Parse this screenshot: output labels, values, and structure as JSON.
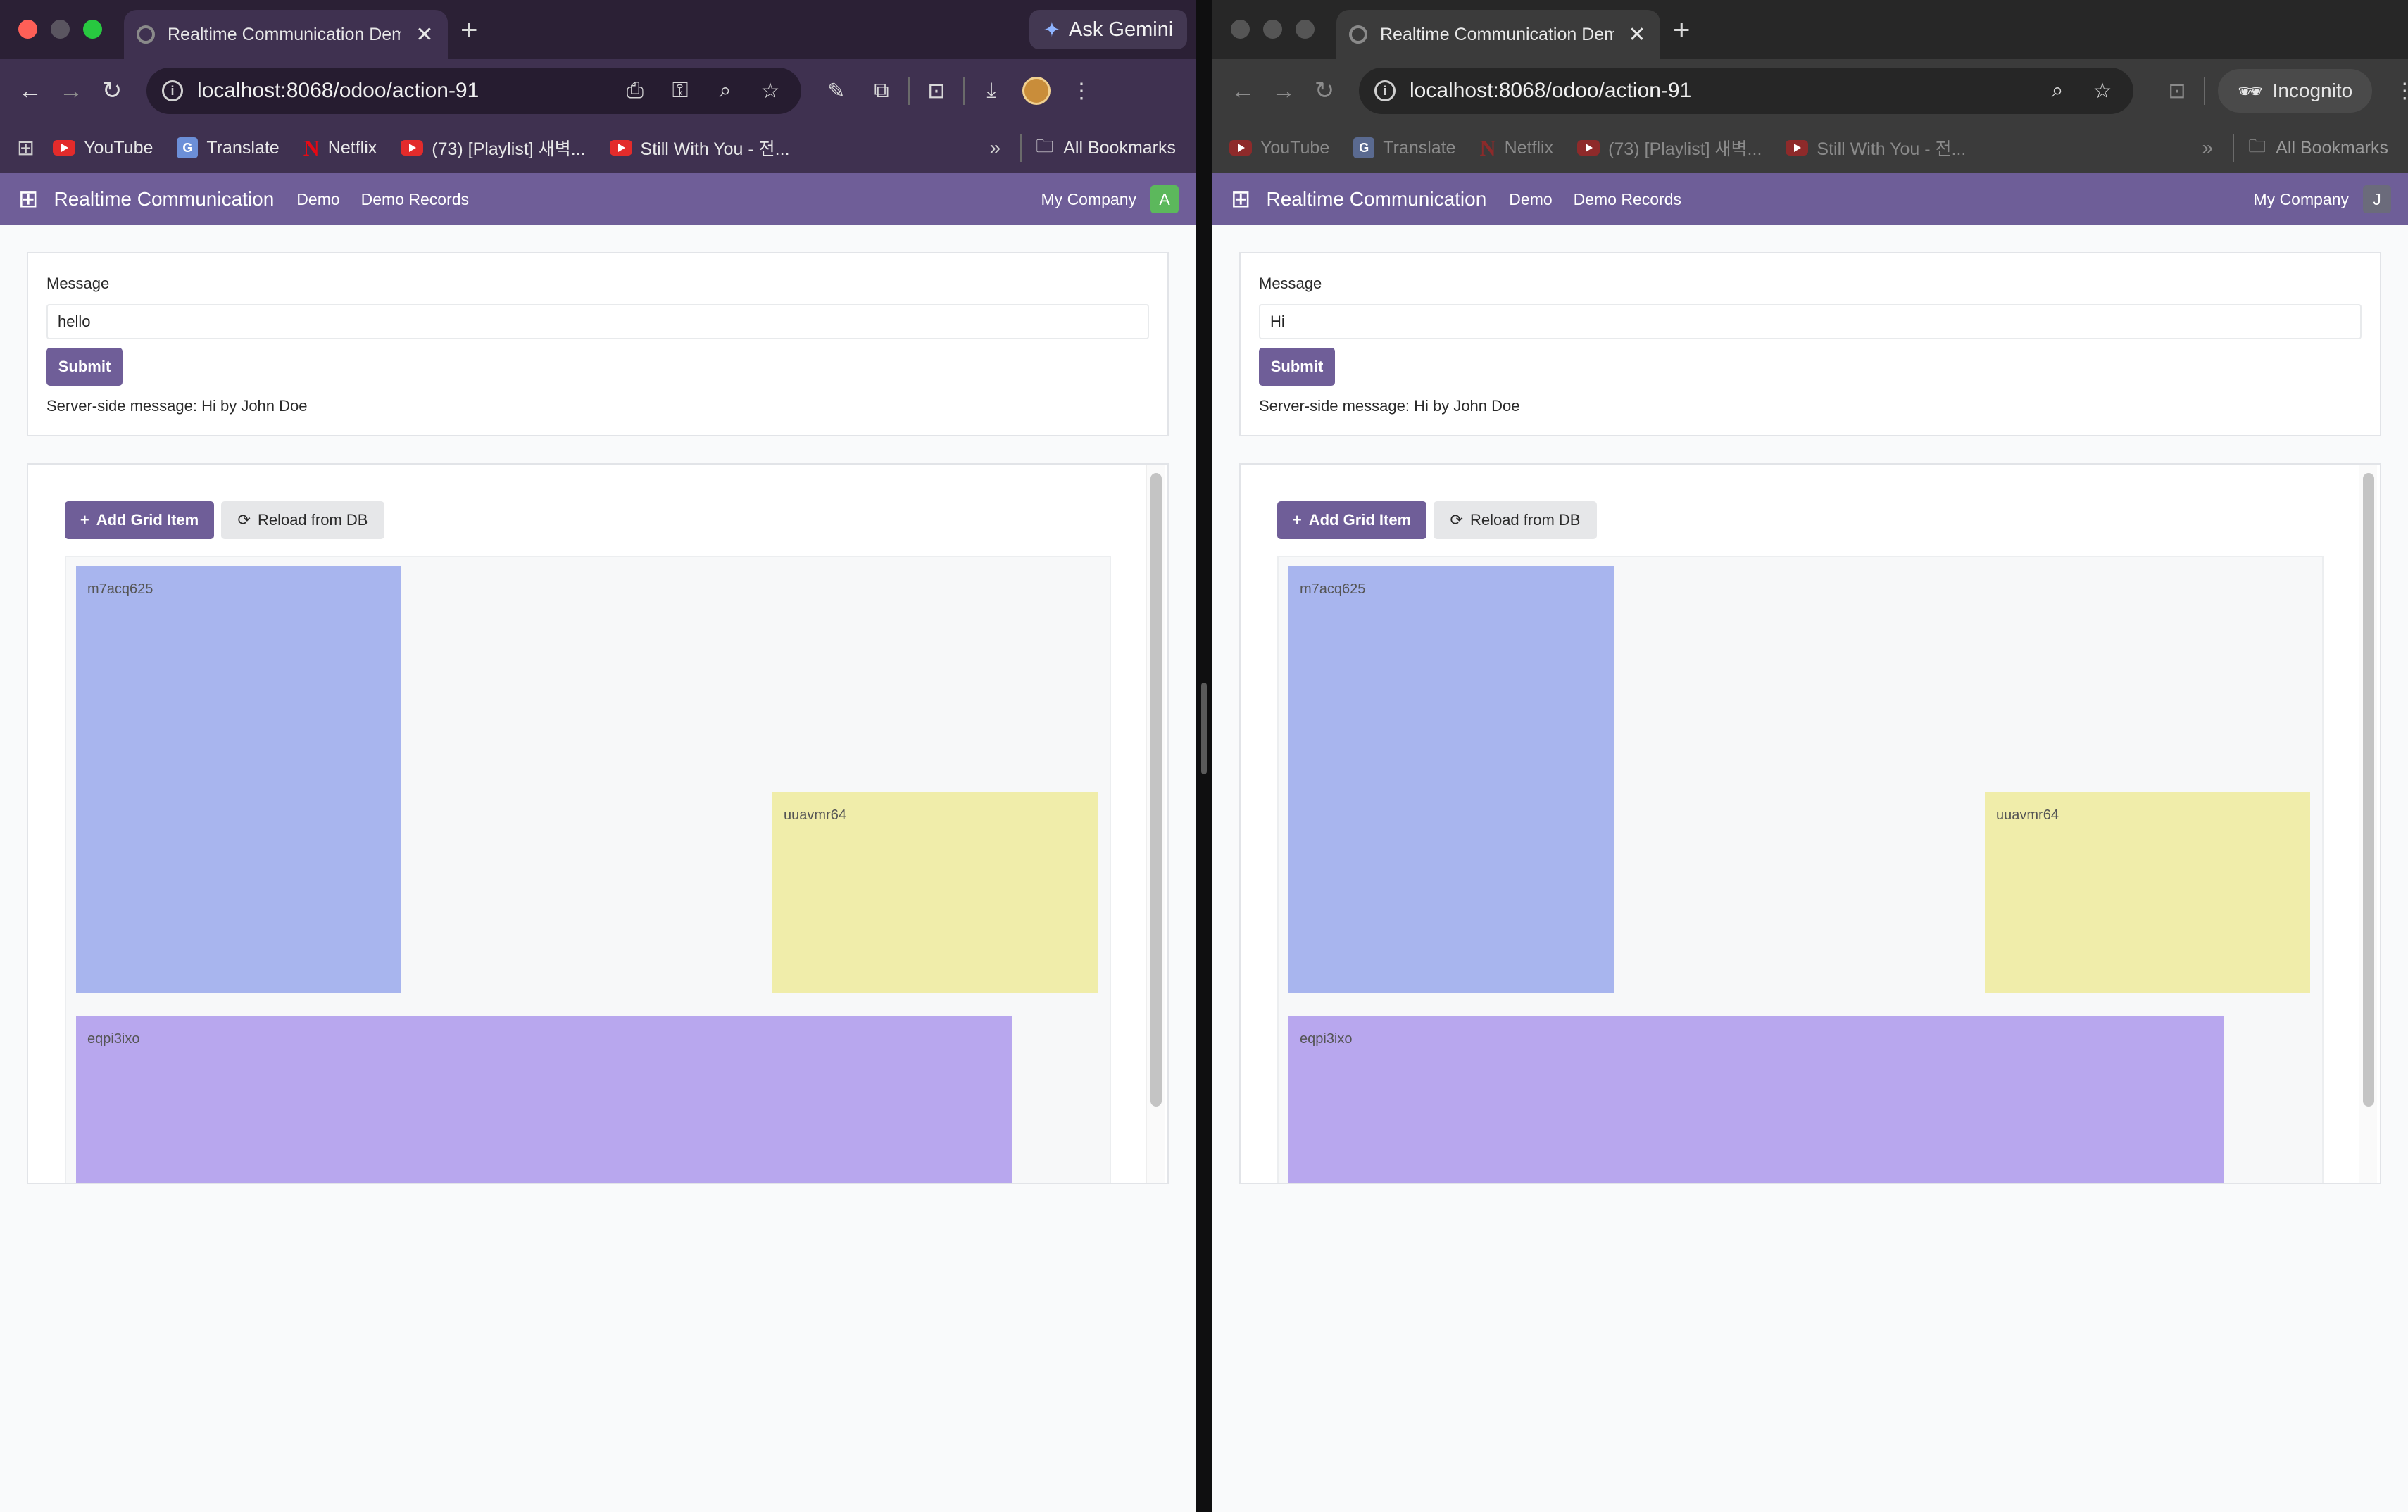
{
  "windows": [
    {
      "tab_title": "Realtime Communication Demo",
      "url": "localhost:8068/odoo/action-91",
      "ask_gemini": "Ask Gemini",
      "incognito_label": "",
      "bookmarks": [
        "YouTube",
        "Translate",
        "Netflix",
        "(73) [Playlist] 새벽...",
        "Still With You - 전..."
      ],
      "all_bookmarks": "All Bookmarks",
      "odoo": {
        "brand": "Realtime Communication",
        "menu": [
          "Demo",
          "Demo Records"
        ],
        "company": "My Company",
        "avatar_letter": "A",
        "avatar_color": "#5cb85c"
      },
      "form": {
        "label": "Message",
        "value": "hello",
        "submit": "Submit",
        "server_message": "Server-side message: Hi by John Doe"
      },
      "grid": {
        "add_label": "Add Grid Item",
        "reload_label": "Reload from DB",
        "items": [
          {
            "id": "m7acq625",
            "color": "#a8b5ee"
          },
          {
            "id": "uuavmr64",
            "color": "#f0edaa"
          },
          {
            "id": "eqpi3ixo",
            "color": "#b8a7ee"
          }
        ]
      }
    },
    {
      "tab_title": "Realtime Communication Demo",
      "url": "localhost:8068/odoo/action-91",
      "ask_gemini": "",
      "incognito_label": "Incognito",
      "bookmarks": [
        "YouTube",
        "Translate",
        "Netflix",
        "(73) [Playlist] 새벽...",
        "Still With You - 전..."
      ],
      "all_bookmarks": "All Bookmarks",
      "odoo": {
        "brand": "Realtime Communication",
        "menu": [
          "Demo",
          "Demo Records"
        ],
        "company": "My Company",
        "avatar_letter": "J",
        "avatar_color": "#6b6b7b"
      },
      "form": {
        "label": "Message",
        "value": "Hi",
        "submit": "Submit",
        "server_message": "Server-side message: Hi by John Doe"
      },
      "grid": {
        "add_label": "Add Grid Item",
        "reload_label": "Reload from DB",
        "items": [
          {
            "id": "m7acq625",
            "color": "#a8b5ee"
          },
          {
            "id": "uuavmr64",
            "color": "#f0edaa"
          },
          {
            "id": "eqpi3ixo",
            "color": "#b8a7ee"
          }
        ]
      }
    }
  ],
  "icons": {
    "back": "arrow-left-icon",
    "forward": "arrow-right-icon",
    "reload": "reload-icon",
    "star": "star-icon",
    "zoom": "zoom-icon",
    "key": "key-icon",
    "download": "download-icon",
    "menu": "kebab-menu-icon",
    "apps": "apps-grid-icon",
    "folder": "folder-icon",
    "incognito": "incognito-icon"
  }
}
